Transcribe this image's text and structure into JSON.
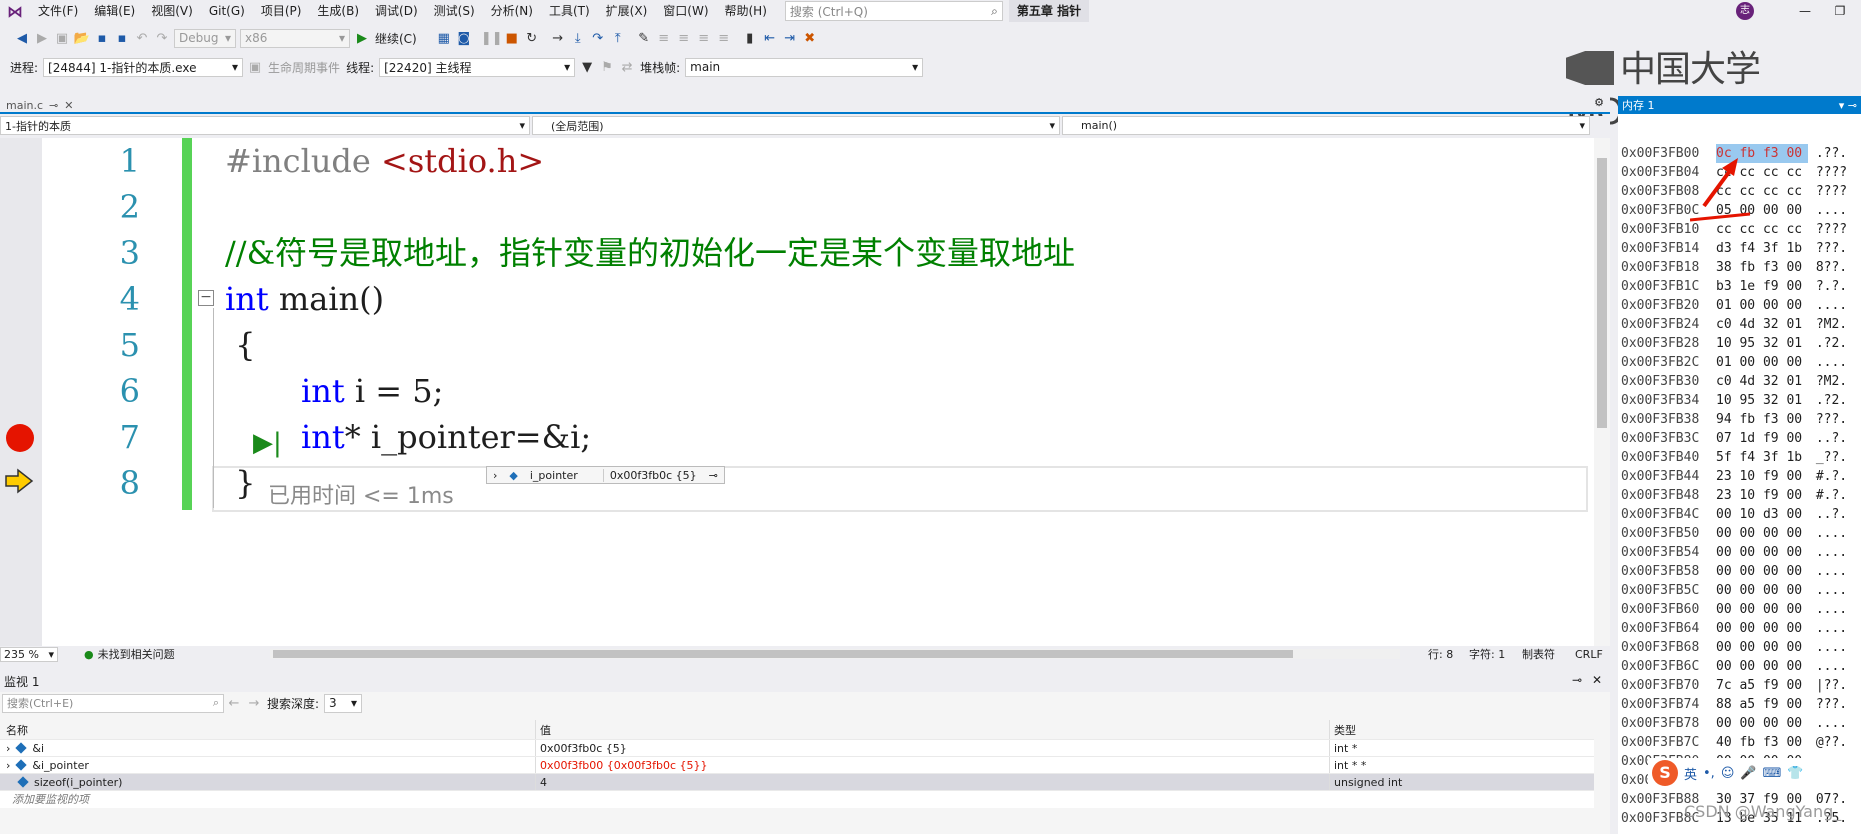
{
  "menu": {
    "items": [
      "文件(F)",
      "编辑(E)",
      "视图(V)",
      "Git(G)",
      "项目(P)",
      "生成(B)",
      "调试(D)",
      "测试(S)",
      "分析(N)",
      "工具(T)",
      "扩展(X)",
      "窗口(W)",
      "帮助(H)"
    ],
    "search_placeholder": "搜索 (Ctrl+Q)",
    "solution": "第五章 指针",
    "user_initial": "志"
  },
  "toolbar": {
    "config": "Debug",
    "platform": "x86",
    "continue_label": "继续(C)",
    "process_label": "进程:",
    "process_value": "[24844] 1-指针的本质.exe",
    "lifecycle_label": "生命周期事件",
    "thread_label": "线程:",
    "thread_value": "[22420] 主线程",
    "stackframe_label": "堆栈帧:",
    "stackframe_value": "main"
  },
  "watermark_logo": "中国大学MOOC",
  "editor": {
    "tab_label": "main.c",
    "nav_project": "1-指针的本质",
    "nav_scope": "(全局范围)",
    "nav_function": "main()",
    "line_numbers": [
      "1",
      "2",
      "3",
      "4",
      "5",
      "6",
      "7",
      "8"
    ],
    "lines": {
      "l1_pp": "#include ",
      "l1_str": "<stdio.h>",
      "l3_comment": "//&符号是取地址，指针变量的初始化一定是某个变量取地址",
      "l4_kw": "int",
      "l4_rest": " main()",
      "l5": " {",
      "l6_kw": "int",
      "l6_rest": " i = 5;",
      "l7_kw": "int",
      "l7_rest": "* i_pointer=&i;",
      "l8": " }"
    },
    "elapsed": "已用时间 <= 1ms",
    "datatip_name": "i_pointer",
    "datatip_value": "0x00f3fb0c {5}",
    "zoom": "235 %",
    "issues": "未找到相关问题",
    "status_line": "行: 8",
    "status_char": "字符: 1",
    "status_tabs": "制表符",
    "status_eol": "CRLF"
  },
  "watch": {
    "title": "监视 1",
    "search_placeholder": "搜索(Ctrl+E)",
    "depth_label": "搜索深度:",
    "depth_value": "3",
    "col_name": "名称",
    "col_value": "值",
    "col_type": "类型",
    "rows": [
      {
        "name": "&i",
        "value": "0x00f3fb0c {5}",
        "type": "int *"
      },
      {
        "name": "&i_pointer",
        "value": "0x00f3fb00 {0x00f3fb0c {5}}",
        "type": "int * *"
      },
      {
        "name": "sizeof(i_pointer)",
        "value": "4",
        "type": "unsigned int"
      }
    ],
    "add_label": "添加要监视的项"
  },
  "memory": {
    "title": "内存 1",
    "rows": [
      {
        "addr": "0x00F3FB00",
        "bytes": "0c fb f3 00",
        "chars": " .??."
      },
      {
        "addr": "0x00F3FB04",
        "bytes": "cc cc cc cc",
        "chars": " ????"
      },
      {
        "addr": "0x00F3FB08",
        "bytes": "cc cc cc cc",
        "chars": " ????"
      },
      {
        "addr": "0x00F3FB0C",
        "bytes": "05 00 00 00",
        "chars": " ...."
      },
      {
        "addr": "0x00F3FB10",
        "bytes": "cc cc cc cc",
        "chars": " ????"
      },
      {
        "addr": "0x00F3FB14",
        "bytes": "d3 f4 3f 1b",
        "chars": " ???."
      },
      {
        "addr": "0x00F3FB18",
        "bytes": "38 fb f3 00",
        "chars": " 8??."
      },
      {
        "addr": "0x00F3FB1C",
        "bytes": "b3 1e f9 00",
        "chars": " ?.?."
      },
      {
        "addr": "0x00F3FB20",
        "bytes": "01 00 00 00",
        "chars": " ...."
      },
      {
        "addr": "0x00F3FB24",
        "bytes": "c0 4d 32 01",
        "chars": " ?M2."
      },
      {
        "addr": "0x00F3FB28",
        "bytes": "10 95 32 01",
        "chars": " .?2."
      },
      {
        "addr": "0x00F3FB2C",
        "bytes": "01 00 00 00",
        "chars": " ...."
      },
      {
        "addr": "0x00F3FB30",
        "bytes": "c0 4d 32 01",
        "chars": " ?M2."
      },
      {
        "addr": "0x00F3FB34",
        "bytes": "10 95 32 01",
        "chars": " .?2."
      },
      {
        "addr": "0x00F3FB38",
        "bytes": "94 fb f3 00",
        "chars": " ???."
      },
      {
        "addr": "0x00F3FB3C",
        "bytes": "07 1d f9 00",
        "chars": " ..?."
      },
      {
        "addr": "0x00F3FB40",
        "bytes": "5f f4 3f 1b",
        "chars": " _??."
      },
      {
        "addr": "0x00F3FB44",
        "bytes": "23 10 f9 00",
        "chars": " #.?."
      },
      {
        "addr": "0x00F3FB48",
        "bytes": "23 10 f9 00",
        "chars": " #.?."
      },
      {
        "addr": "0x00F3FB4C",
        "bytes": "00 10 d3 00",
        "chars": " ..?."
      },
      {
        "addr": "0x00F3FB50",
        "bytes": "00 00 00 00",
        "chars": " ...."
      },
      {
        "addr": "0x00F3FB54",
        "bytes": "00 00 00 00",
        "chars": " ...."
      },
      {
        "addr": "0x00F3FB58",
        "bytes": "00 00 00 00",
        "chars": " ...."
      },
      {
        "addr": "0x00F3FB5C",
        "bytes": "00 00 00 00",
        "chars": " ...."
      },
      {
        "addr": "0x00F3FB60",
        "bytes": "00 00 00 00",
        "chars": " ...."
      },
      {
        "addr": "0x00F3FB64",
        "bytes": "00 00 00 00",
        "chars": " ...."
      },
      {
        "addr": "0x00F3FB68",
        "bytes": "00 00 00 00",
        "chars": " ...."
      },
      {
        "addr": "0x00F3FB6C",
        "bytes": "00 00 00 00",
        "chars": " ...."
      },
      {
        "addr": "0x00F3FB70",
        "bytes": "7c a5 f9 00",
        "chars": " |??."
      },
      {
        "addr": "0x00F3FB74",
        "bytes": "88 a5 f9 00",
        "chars": " ???."
      },
      {
        "addr": "0x00F3FB78",
        "bytes": "00 00 00 00",
        "chars": " ...."
      },
      {
        "addr": "0x00F3FB7C",
        "bytes": "40 fb f3 00",
        "chars": " @??."
      },
      {
        "addr": "0x00F3FB80",
        "bytes": "00 00 00 00",
        "chars": " ...."
      },
      {
        "addr": "0x00F3FB84",
        "bytes": "",
        "chars": ""
      },
      {
        "addr": "0x00F3FB88",
        "bytes": "30 37 f9 00",
        "chars": " 07?."
      },
      {
        "addr": "0x00F3FB8C",
        "bytes": "13 be 35 11",
        "chars": " .?5."
      }
    ]
  },
  "ime": {
    "lang": "英",
    "punct": "•,"
  },
  "csdn_watermark": "CSDN @WangYang_"
}
